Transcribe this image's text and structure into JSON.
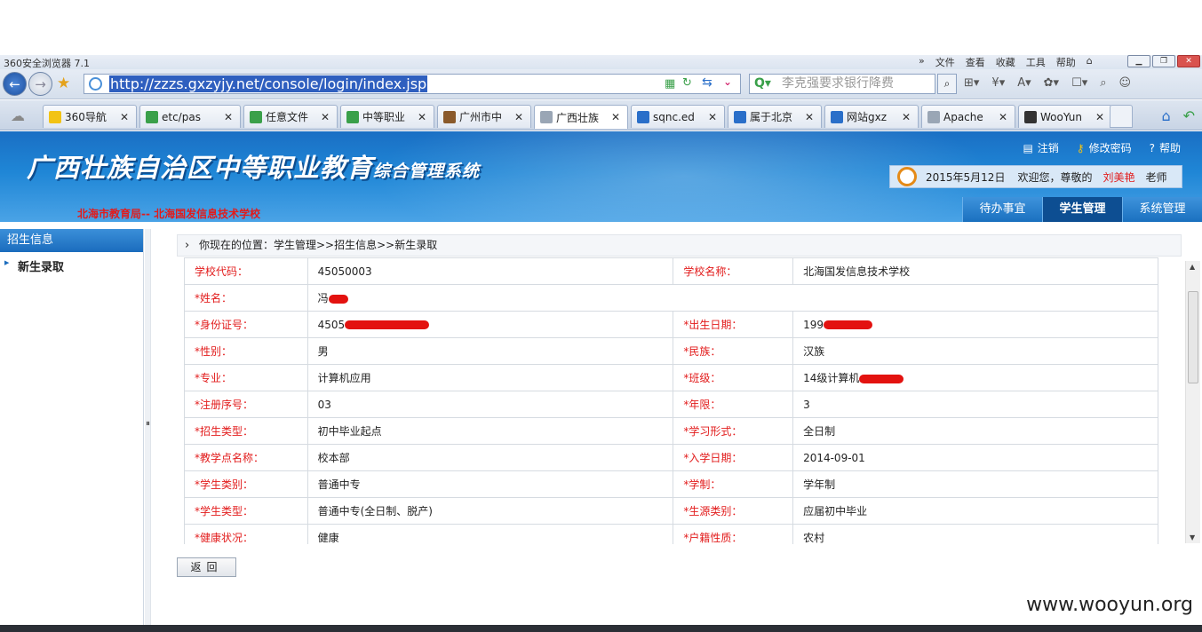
{
  "browser": {
    "app_name": "360安全浏览器 7.1",
    "menus": [
      "文件",
      "查看",
      "收藏",
      "工具",
      "帮助"
    ],
    "url": "http://zzzs.gxzyjy.net/console/login/index.jsp",
    "search_placeholder": "李克强要求银行降费",
    "tabs": [
      {
        "label": "360导航",
        "icon_color": "#f2c315",
        "active": false
      },
      {
        "label": "etc/pas",
        "icon_color": "#3aa04a",
        "active": false
      },
      {
        "label": "任意文件",
        "icon_color": "#3aa04a",
        "active": false
      },
      {
        "label": "中等职业",
        "icon_color": "#3aa04a",
        "active": false
      },
      {
        "label": "广州市中",
        "icon_color": "#8a5a2b",
        "active": false
      },
      {
        "label": "广西壮族",
        "icon_color": "#9aa6b5",
        "active": true
      },
      {
        "label": "sqnc.ed",
        "icon_color": "#2a6fc9",
        "active": false
      },
      {
        "label": "属于北京",
        "icon_color": "#2a6fc9",
        "active": false
      },
      {
        "label": "网站gxz",
        "icon_color": "#2a6fc9",
        "active": false
      },
      {
        "label": "Apache",
        "icon_color": "#9aa6b5",
        "active": false
      },
      {
        "label": "WooYun",
        "icon_color": "#333333",
        "active": false
      }
    ]
  },
  "header": {
    "title_main": "广西壮族自治区中等职业教育",
    "title_sub": "综合管理系统",
    "school": "北海市教育局-- 北海国发信息技术学校",
    "links": {
      "logout": "注销",
      "change_pwd": "修改密码",
      "help": "帮助"
    },
    "date": "2015年5月12日",
    "greeting": "欢迎您，尊敬的",
    "user_name": "刘美艳",
    "user_role": "老师",
    "nav": [
      {
        "label": "待办事宜",
        "active": false
      },
      {
        "label": "学生管理",
        "active": true
      },
      {
        "label": "系统管理",
        "active": false
      }
    ]
  },
  "sidebar": {
    "section": "招生信息",
    "items": [
      "新生录取"
    ]
  },
  "main": {
    "breadcrumb": "你现在的位置：学生管理>>招生信息>>新生录取",
    "rows": [
      {
        "l1": "学校代码：",
        "v1": "45050003",
        "l2": "学校名称：",
        "v2": "北海国发信息技术学校"
      },
      {
        "l1": "*姓名：",
        "v1": "冯",
        "full": true,
        "r1": 22
      },
      {
        "l1": "*身份证号：",
        "v1": "4505",
        "l2": "*出生日期：",
        "v2": "199",
        "r1": 95,
        "r2": 55
      },
      {
        "l1": "*性别：",
        "v1": "男",
        "l2": "*民族：",
        "v2": "汉族"
      },
      {
        "l1": "*专业：",
        "v1": "计算机应用",
        "l2": "*班级：",
        "v2": "14级计算机",
        "r2": 50
      },
      {
        "l1": "*注册序号：",
        "v1": "03",
        "l2": "*年限：",
        "v2": "3"
      },
      {
        "l1": "*招生类型：",
        "v1": "初中毕业起点",
        "l2": "*学习形式：",
        "v2": "全日制"
      },
      {
        "l1": "*教学点名称：",
        "v1": "校本部",
        "l2": "*入学日期：",
        "v2": "2014-09-01"
      },
      {
        "l1": "*学生类别：",
        "v1": "普通中专",
        "l2": "*学制：",
        "v2": "学年制"
      },
      {
        "l1": "*学生类型：",
        "v1": "普通中专(全日制、脱产)",
        "l2": "*生源类别：",
        "v2": "应届初中毕业"
      },
      {
        "l1": "*健康状况：",
        "v1": "健康",
        "l2": "*户籍性质：",
        "v2": "农村"
      }
    ],
    "back_button": "返回"
  },
  "watermark": "www.wooyun.org"
}
